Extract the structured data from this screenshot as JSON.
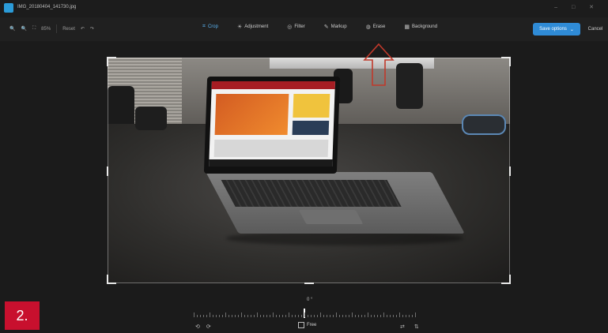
{
  "window": {
    "file_name": "IMG_20180404_141730.jpg",
    "controls": [
      "–",
      "□",
      "✕"
    ]
  },
  "toolbar": {
    "zoom_level": "85%",
    "reset_label": "Reset",
    "tabs": [
      {
        "label": "Crop",
        "icon": "crop-icon",
        "active": true
      },
      {
        "label": "Adjustment",
        "icon": "adjust-icon",
        "active": false
      },
      {
        "label": "Filter",
        "icon": "filter-icon",
        "active": false
      },
      {
        "label": "Markup",
        "icon": "markup-icon",
        "active": false
      },
      {
        "label": "Erase",
        "icon": "erase-icon",
        "active": false
      },
      {
        "label": "Background",
        "icon": "background-icon",
        "active": false
      }
    ],
    "save_label": "Save options",
    "cancel_label": "Cancel"
  },
  "crop": {
    "angle_label": "0 °",
    "aspect_label": "Free"
  },
  "overlay": {
    "step_label": "2."
  },
  "colors": {
    "accent": "#59b2f0",
    "save_button": "#2f8bd6",
    "step_badge": "#c8102e",
    "annotation_arrow": "#c0392b"
  }
}
